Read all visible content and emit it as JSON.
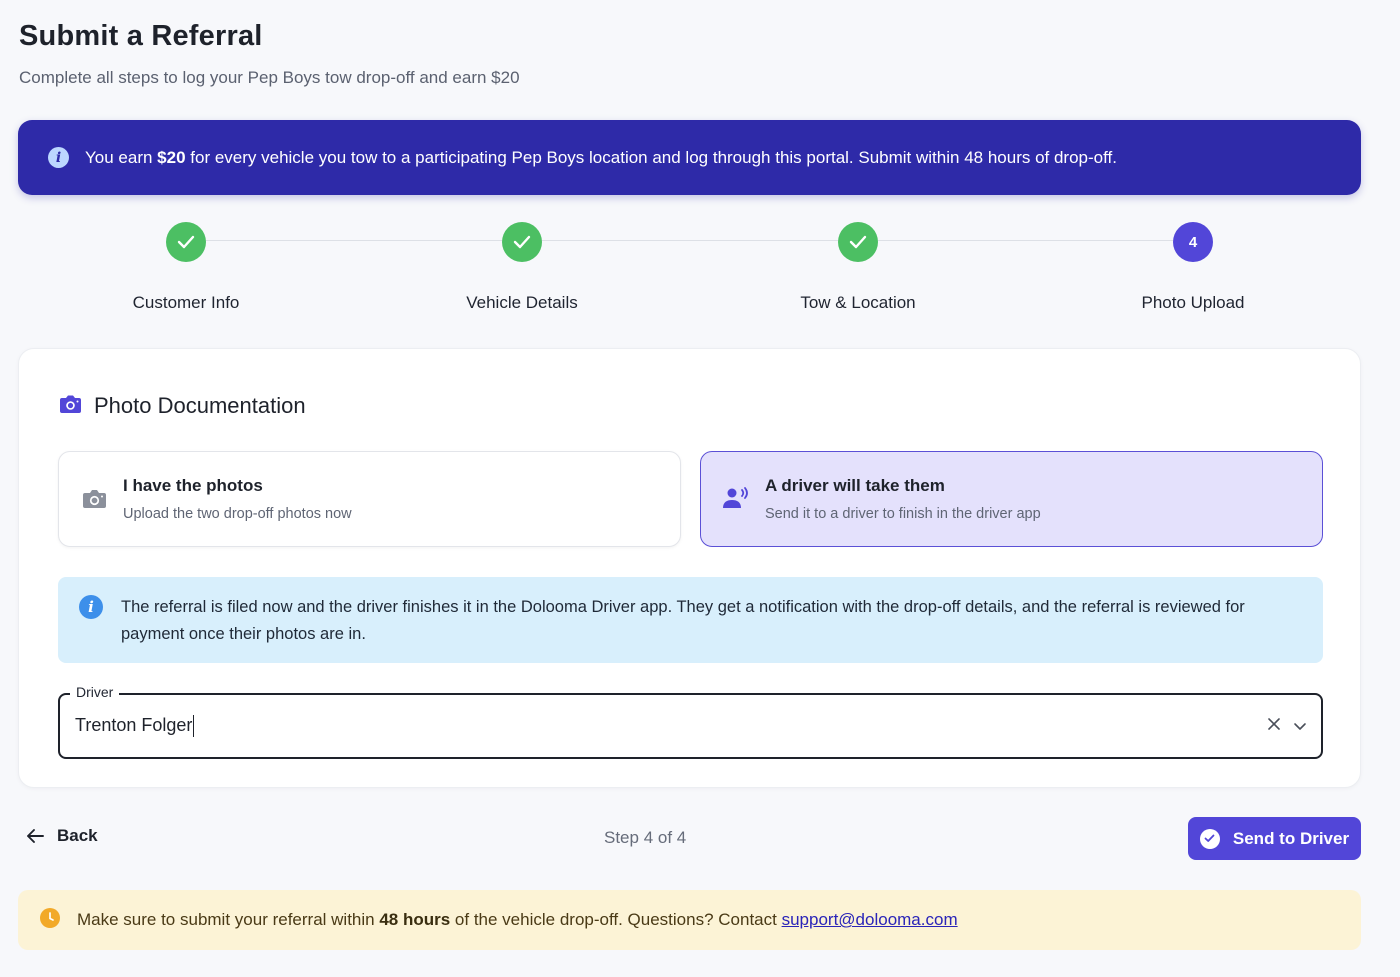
{
  "header": {
    "title": "Submit a Referral",
    "subtitle": "Complete all steps to log your Pep Boys tow drop-off and earn $20"
  },
  "banner": {
    "text_before": "You earn ",
    "amount": "$20",
    "text_after": " for every vehicle you tow to a participating Pep Boys location and log through this portal. Submit within 48 hours of drop-off.",
    "icon": "info-icon"
  },
  "stepper": {
    "steps": [
      {
        "label": "Customer Info",
        "status": "done"
      },
      {
        "label": "Vehicle Details",
        "status": "done"
      },
      {
        "label": "Tow & Location",
        "status": "done"
      },
      {
        "label": "Photo Upload",
        "status": "active",
        "number": "4"
      }
    ]
  },
  "card": {
    "title": "Photo Documentation",
    "options": [
      {
        "title": "I have the photos",
        "desc": "Upload the two drop-off photos now",
        "selected": false,
        "icon": "camera-icon"
      },
      {
        "title": "A driver will take them",
        "desc": "Send it to a driver to finish in the driver app",
        "selected": true,
        "icon": "driver-notify-icon"
      }
    ],
    "note": "The referral is filed now and the driver finishes it in the Dolooma Driver app. They get a notification with the drop-off details, and the referral is reviewed for payment once their photos are in.",
    "driver_field": {
      "label": "Driver",
      "value": "Trenton Folger"
    }
  },
  "footer": {
    "back_label": "Back",
    "step_count": "Step 4 of 4",
    "send_label": "Send to Driver"
  },
  "warning": {
    "text_before": "Make sure to submit your referral within ",
    "bold": "48 hours",
    "text_middle": " of the vehicle drop-off. Questions? Contact ",
    "email": "support@dolooma.com"
  },
  "colors": {
    "brand": "#2e2aa8",
    "accent": "#5246d8",
    "success": "#4cbf63",
    "info_bg": "#d8effc",
    "warn_bg": "#fcf3d6"
  }
}
